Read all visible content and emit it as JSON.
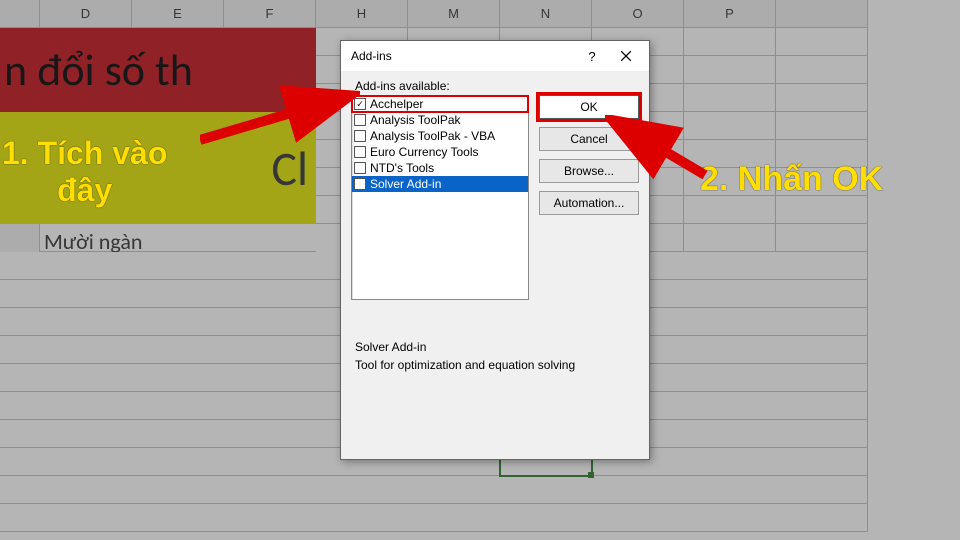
{
  "columns": [
    "D",
    "E",
    "F",
    "H",
    "M",
    "N",
    "O",
    "P"
  ],
  "banner_red": "n đổi số th",
  "banner_yellow": "Cl",
  "cell_text": "Mười ngàn",
  "dialog": {
    "title": "Add-ins",
    "help": "?",
    "label": "Add-ins available:",
    "items": [
      {
        "name": "Acchelper",
        "checked": true,
        "highlight": true
      },
      {
        "name": "Analysis ToolPak",
        "checked": false
      },
      {
        "name": "Analysis ToolPak - VBA",
        "checked": false
      },
      {
        "name": "Euro Currency Tools",
        "checked": false
      },
      {
        "name": "NTD's Tools",
        "checked": false
      },
      {
        "name": "Solver Add-in",
        "checked": false,
        "selected": true
      }
    ],
    "buttons": {
      "ok": "OK",
      "cancel": "Cancel",
      "browse": "Browse...",
      "automation": "Automation..."
    },
    "desc_title": "Solver Add-in",
    "desc_text": "Tool for optimization and equation solving"
  },
  "annotations": {
    "step1_a": "1. Tích vào",
    "step1_b": "đây",
    "step2": "2. Nhấn OK"
  }
}
